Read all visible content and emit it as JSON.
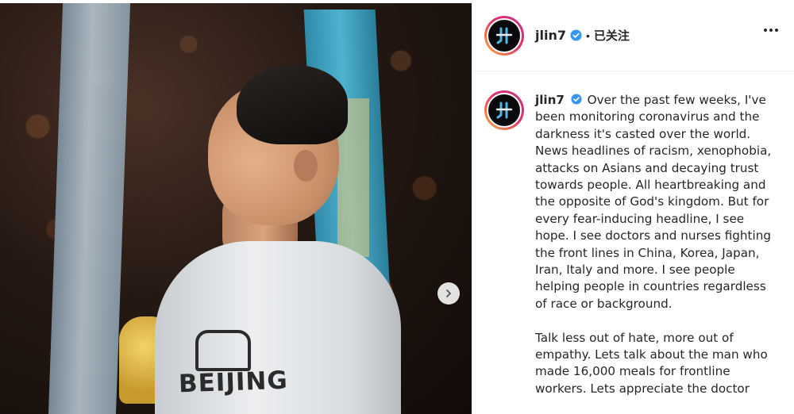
{
  "post": {
    "username": "jlin7",
    "separator": "•",
    "follow_status": "已关注",
    "jersey_text": "BEIJING"
  },
  "caption": {
    "username": "jlin7",
    "paragraph1": "Over the past few weeks, I've been monitoring coronavirus and the darkness it's casted over the world. News headlines of racism, xenophobia, attacks on Asians and decaying trust towards people. All heartbreaking and the opposite of God's kingdom. But for every fear-inducing headline, I see hope. I see doctors and nurses fighting the front lines in China, Korea, Japan, Iran, Italy and more. I see people helping people in countries regardless of race or background.",
    "paragraph2": "Talk less out of hate, more out of empathy. Lets talk about the man who made 16,000 meals for frontline workers. Lets appreciate the doctor"
  },
  "colors": {
    "verified": "#3897f0",
    "story_ring_start": "#f9b13a",
    "story_ring_end": "#c13584",
    "text": "#262626"
  },
  "icons": {
    "verified": "verified-badge-icon",
    "more": "more-options-icon",
    "next": "chevron-right-icon"
  }
}
